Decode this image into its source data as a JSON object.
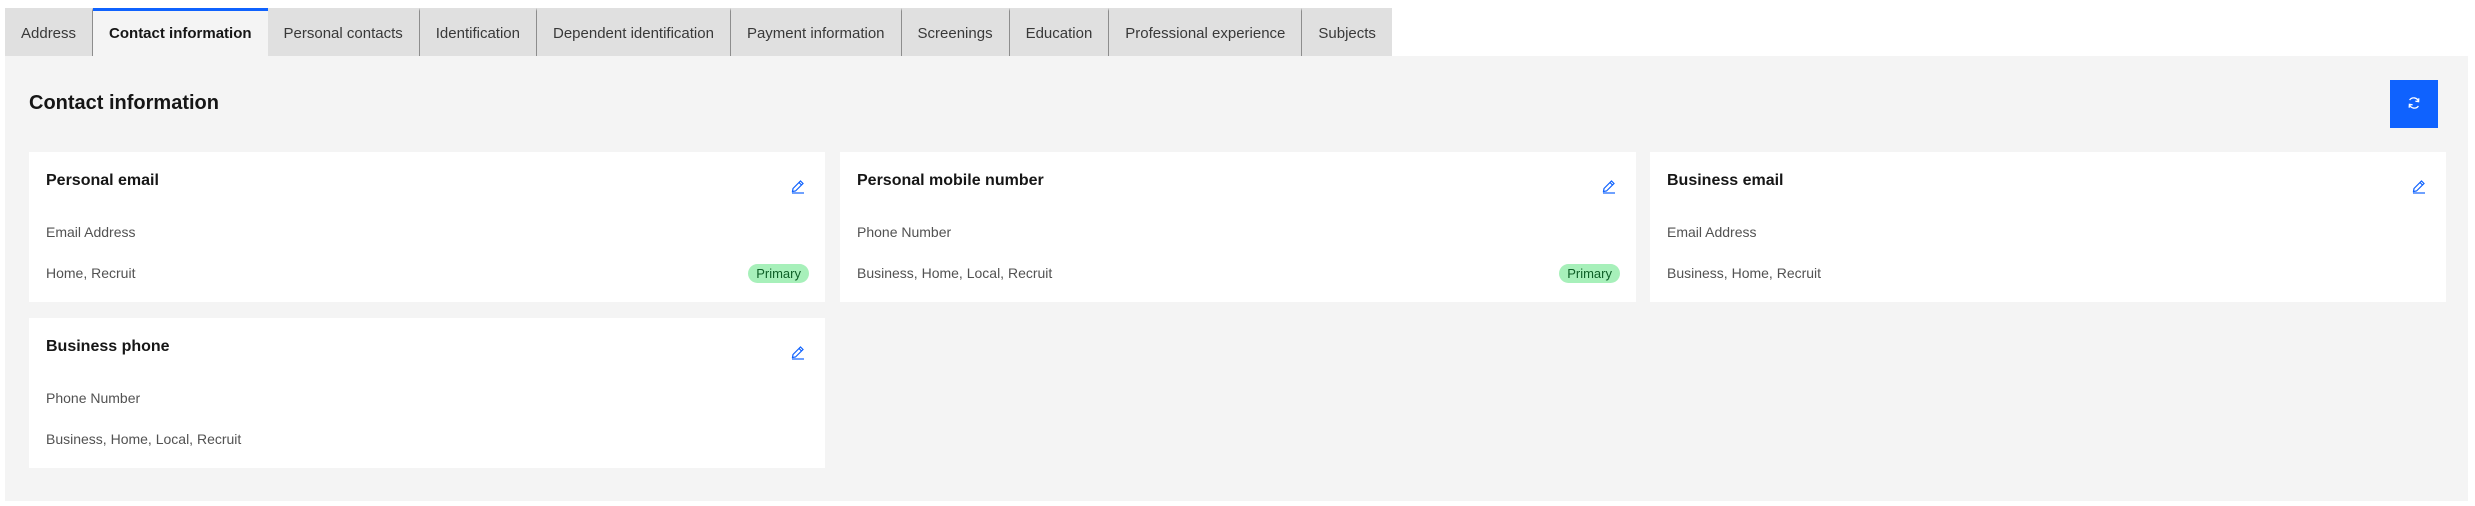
{
  "tabs": [
    {
      "label": "Address",
      "active": false
    },
    {
      "label": "Contact information",
      "active": true
    },
    {
      "label": "Personal contacts",
      "active": false
    },
    {
      "label": "Identification",
      "active": false
    },
    {
      "label": "Dependent identification",
      "active": false
    },
    {
      "label": "Payment information",
      "active": false
    },
    {
      "label": "Screenings",
      "active": false
    },
    {
      "label": "Education",
      "active": false
    },
    {
      "label": "Professional experience",
      "active": false
    },
    {
      "label": "Subjects",
      "active": false
    }
  ],
  "panel": {
    "title": "Contact information",
    "refresh_icon": "refresh-icon"
  },
  "cards": [
    {
      "title": "Personal email",
      "type": "Email Address",
      "tags": "Home, Recruit",
      "badge": "Primary"
    },
    {
      "title": "Personal mobile number",
      "type": "Phone Number",
      "tags": "Business, Home, Local, Recruit",
      "badge": "Primary"
    },
    {
      "title": "Business email",
      "type": "Email Address",
      "tags": "Business, Home, Recruit",
      "badge": ""
    },
    {
      "title": "Business phone",
      "type": "Phone Number",
      "tags": "Business, Home, Local, Recruit",
      "badge": ""
    }
  ],
  "colors": {
    "accent": "#0f62fe",
    "badge_bg": "#a7f0ba",
    "badge_text": "#0e6027",
    "panel_bg": "#f4f4f4",
    "tab_bg": "#e0e0e0"
  }
}
